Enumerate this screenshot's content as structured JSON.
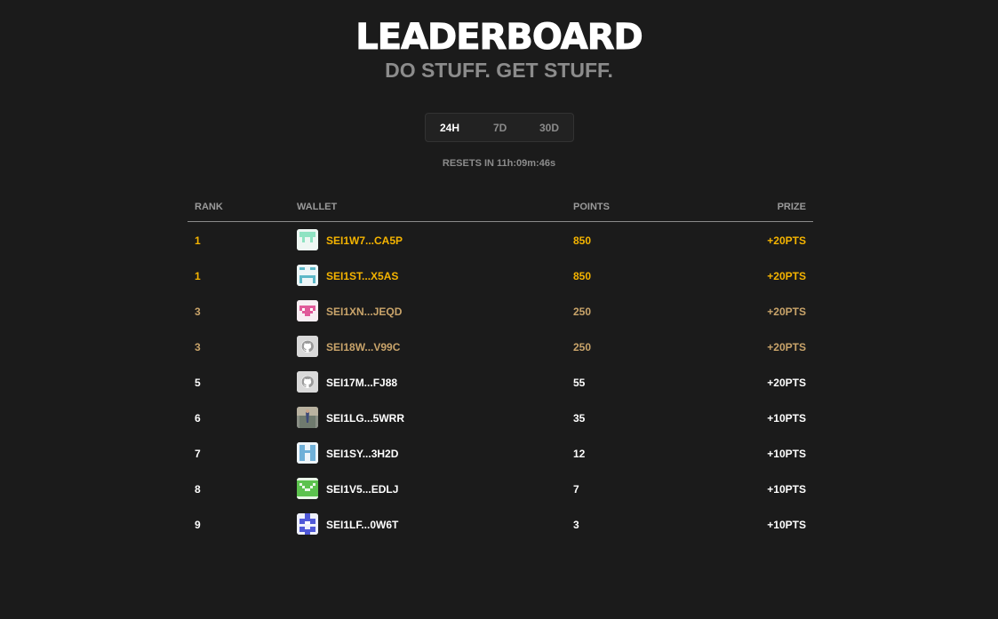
{
  "header": {
    "title": "LEADERBOARD",
    "subtitle": "DO STUFF. GET STUFF."
  },
  "tabs": [
    {
      "label": "24H",
      "active": true
    },
    {
      "label": "7D",
      "active": false
    },
    {
      "label": "30D",
      "active": false
    }
  ],
  "resets_text": "RESETS IN 11h:09m:46s",
  "table": {
    "columns": {
      "rank": "RANK",
      "wallet": "WALLET",
      "points": "POINTS",
      "prize": "PRIZE"
    },
    "rows": [
      {
        "rank": "1",
        "wallet": "SEI1W7...CA5P",
        "points": "850",
        "prize": "+20PTS",
        "color": "#f5b400",
        "avatar": "mint-pixel-icon"
      },
      {
        "rank": "1",
        "wallet": "SEI1ST...X5AS",
        "points": "850",
        "prize": "+20PTS",
        "color": "#f5b400",
        "avatar": "teal-pixel-icon"
      },
      {
        "rank": "3",
        "wallet": "SEI1XN...JEQD",
        "points": "250",
        "prize": "+20PTS",
        "color": "#c9a46a",
        "avatar": "pink-pixel-icon"
      },
      {
        "rank": "3",
        "wallet": "SEI18W...V99C",
        "points": "250",
        "prize": "+20PTS",
        "color": "#c9a46a",
        "avatar": "github-icon"
      },
      {
        "rank": "5",
        "wallet": "SEI17M...FJ88",
        "points": "55",
        "prize": "+20PTS",
        "color": "#ffffff",
        "avatar": "github-icon"
      },
      {
        "rank": "6",
        "wallet": "SEI1LG...5WRR",
        "points": "35",
        "prize": "+10PTS",
        "color": "#ffffff",
        "avatar": "photo-avatar-icon"
      },
      {
        "rank": "7",
        "wallet": "SEI1SY...3H2D",
        "points": "12",
        "prize": "+10PTS",
        "color": "#ffffff",
        "avatar": "blue-pixel-icon"
      },
      {
        "rank": "8",
        "wallet": "SEI1V5...EDLJ",
        "points": "7",
        "prize": "+10PTS",
        "color": "#ffffff",
        "avatar": "green-pixel-icon"
      },
      {
        "rank": "9",
        "wallet": "SEI1LF...0W6T",
        "points": "3",
        "prize": "+10PTS",
        "color": "#ffffff",
        "avatar": "indigo-pixel-icon"
      }
    ]
  },
  "colors": {
    "background": "#1b1b1b",
    "gold": "#f5b400",
    "bronze": "#c9a46a",
    "muted": "#8c8c8c"
  }
}
